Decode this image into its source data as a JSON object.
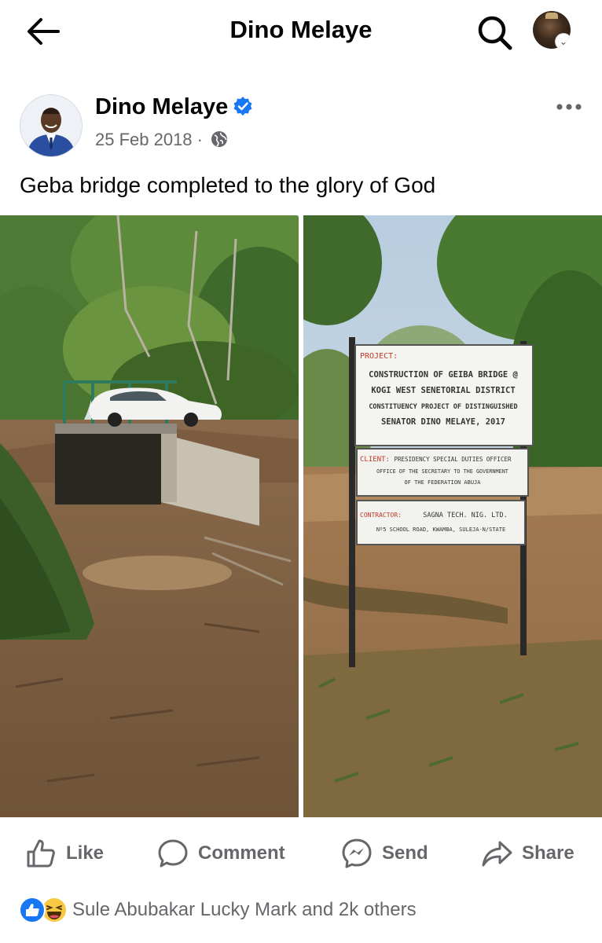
{
  "header": {
    "title": "Dino Melaye",
    "back_icon": "arrow-left-icon",
    "search_icon": "search-icon"
  },
  "post": {
    "author": "Dino Melaye",
    "date": "25 Feb 2018",
    "separator": "·",
    "audience_icon": "globe-icon",
    "caption": "Geba bridge completed to the glory of God",
    "more_icon": "more-horizontal-icon",
    "sign": {
      "project_label": "PROJECT:",
      "project_lines": [
        "CONSTRUCTION OF GEIBA BRIDGE @",
        "KOGI WEST SENETORIAL DISTRICT",
        "CONSTITUENCY PROJECT OF DISTINGUISHED",
        "SENATOR DINO MELAYE, 2017"
      ],
      "client_label": "CLIENT:",
      "client_lines": [
        "PRESIDENCY SPECIAL DUTIES OFFICER",
        "OFFICE OF THE SECRETARY TO THE GOVERNMENT",
        "OF THE FEDERATION ABUJA"
      ],
      "contractor_label": "CONTRACTOR:",
      "contractor_lines": [
        "SAGNA TECH. NIG. LTD.",
        "Nº5 SCHOOL ROAD, KWAMBA, SULEJA-N/STATE"
      ]
    }
  },
  "actions": {
    "like": "Like",
    "comment": "Comment",
    "send": "Send",
    "share": "Share"
  },
  "reactions": {
    "summary": "Sule Abubakar Lucky Mark and 2k others"
  },
  "colors": {
    "accent": "#1877f2",
    "muted": "#65676b",
    "text": "#050505"
  }
}
